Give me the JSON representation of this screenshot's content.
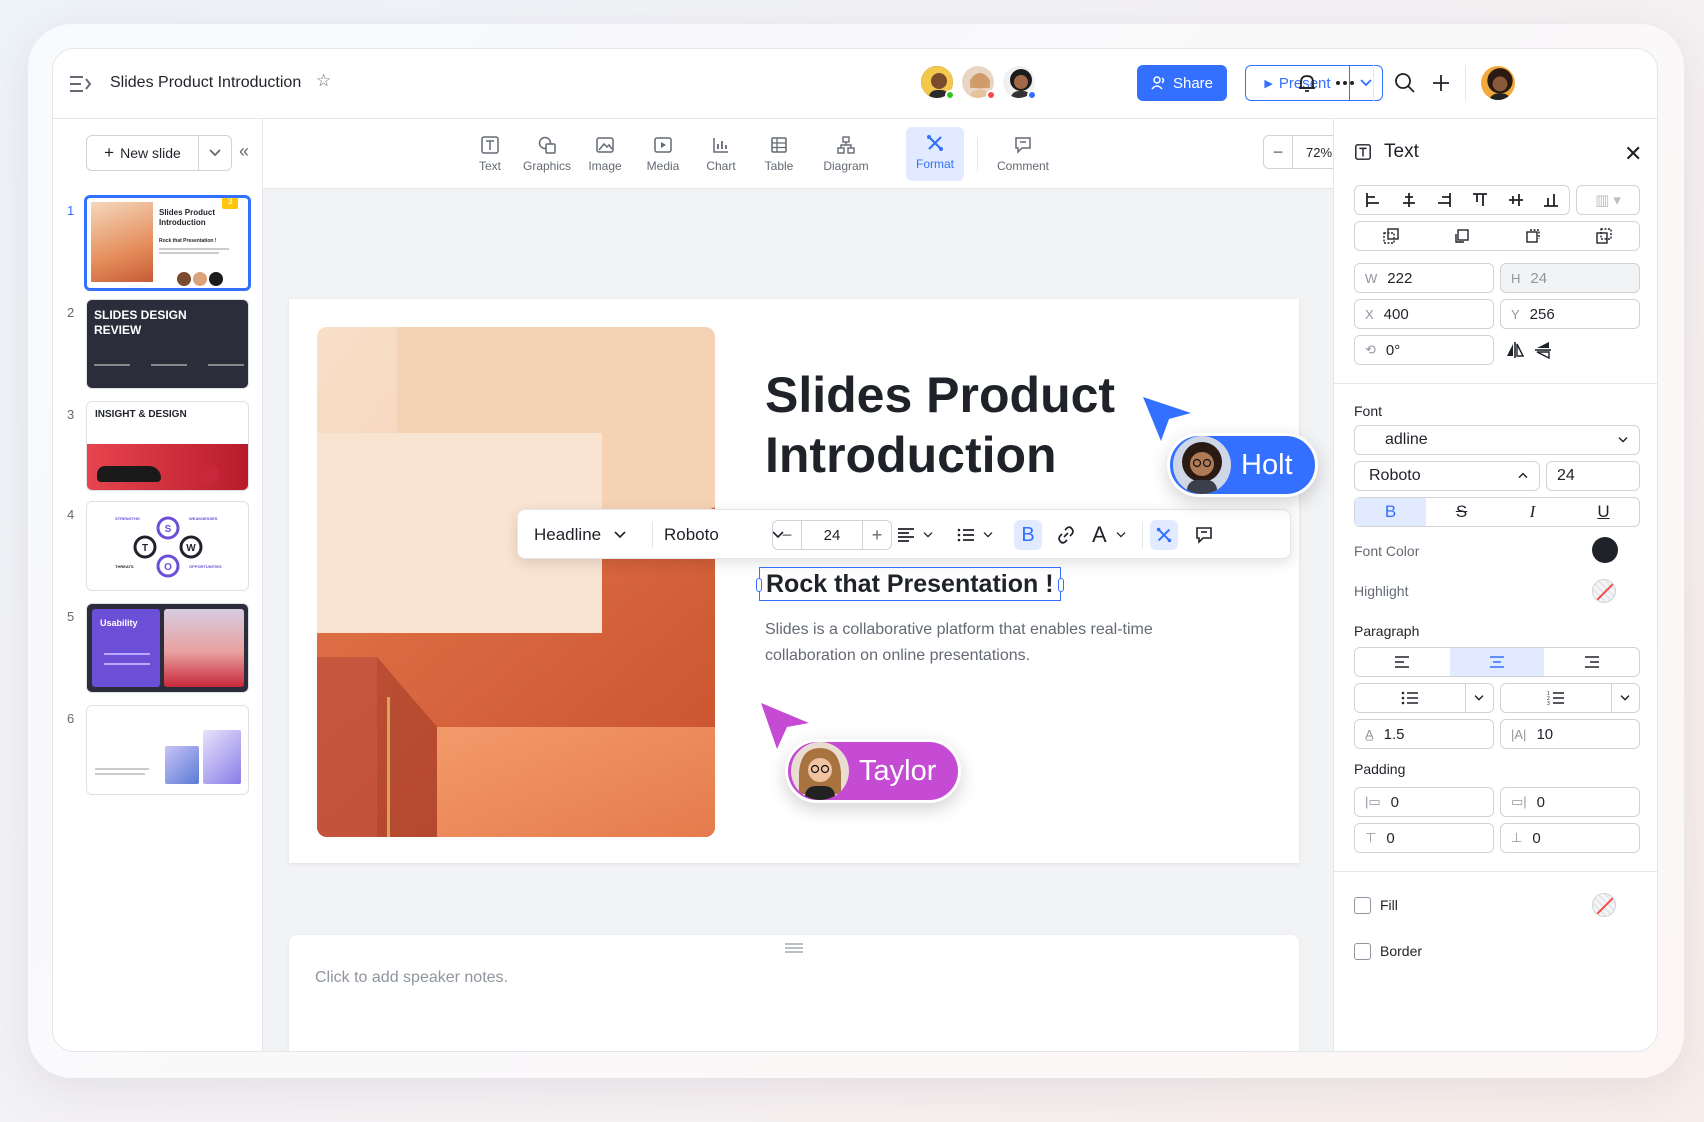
{
  "header": {
    "title": "Slides Product Introduction",
    "share_label": "Share",
    "present_label": "Present"
  },
  "sidebar": {
    "new_slide_label": "New slide",
    "slides": [
      {
        "num": "1",
        "title": "Slides Product Introduction",
        "subtitle": "Rock that Presentation !",
        "comment_badge": "3"
      },
      {
        "num": "2",
        "title": "SLIDES DESIGN REVIEW"
      },
      {
        "num": "3",
        "title": "INSIGHT & DESIGN"
      },
      {
        "num": "4",
        "title": "",
        "swot": {
          "strengths": "STRENGTHS",
          "weaknesses": "WEAKNESSES",
          "threats": "THREATS",
          "opportunities": "OPPORTUNITIES",
          "s": "S",
          "w": "W",
          "t": "T",
          "o": "O"
        }
      },
      {
        "num": "5",
        "title": "Usability"
      },
      {
        "num": "6",
        "title": ""
      }
    ]
  },
  "toolbar": {
    "tools": [
      "Text",
      "Graphics",
      "Image",
      "Media",
      "Chart",
      "Table",
      "Diagram",
      "Format",
      "Comment"
    ],
    "active_tool": "Format",
    "zoom": "72%"
  },
  "slide": {
    "title": "Slides Product Introduction",
    "subtitle": "Rock that Presentation !",
    "body": "Slides is a collaborative platform that enables real-time collaboration on online presentations."
  },
  "floating_toolbar": {
    "style": "Headline",
    "font": "Roboto",
    "size": "24"
  },
  "collaborators": [
    {
      "name": "Holt",
      "color": "#3370ff"
    },
    {
      "name": "Taylor",
      "color": "#c64bd4"
    }
  ],
  "notes": {
    "placeholder": "Click to add speaker notes."
  },
  "panel": {
    "title": "Text",
    "w": "222",
    "h": "24",
    "x": "400",
    "y": "256",
    "rotation": "0°",
    "w_label": "W",
    "h_label": "H",
    "x_label": "X",
    "y_label": "Y",
    "font_section": "Font",
    "font_style": "adline",
    "font_family": "Roboto",
    "font_size": "24",
    "font_color_label": "Font Color",
    "highlight_label": "Highlight",
    "paragraph_section": "Paragraph",
    "line_spacing": "1.5",
    "letter_spacing": "10",
    "padding_section": "Padding",
    "padding": [
      "0",
      "0",
      "0",
      "0"
    ],
    "fill_label": "Fill",
    "border_label": "Border"
  },
  "colors": {
    "accent": "#3370ff",
    "taylor": "#c64bd4",
    "text": "#1f2329"
  }
}
